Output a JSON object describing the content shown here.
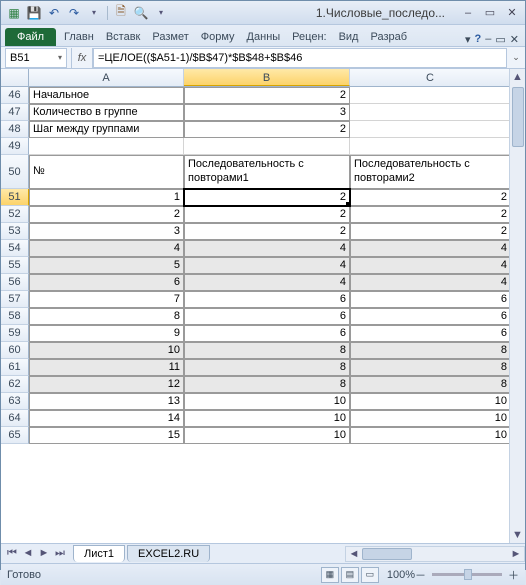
{
  "window": {
    "title": "1.Числовые_последо..."
  },
  "ribbon": {
    "file": "Файл",
    "tabs": [
      "Главн",
      "Вставк",
      "Размет",
      "Форму",
      "Данны",
      "Рецен:",
      "Вид",
      "Разраб"
    ]
  },
  "formulaBar": {
    "nameBox": "B51",
    "fx": "fx",
    "formula": "=ЦЕЛОЕ(($A51-1)/$B$47)*$B$48+$B$46"
  },
  "columns": [
    "A",
    "B",
    "C"
  ],
  "rows": [
    {
      "n": "46",
      "a": "Начальное",
      "b": "2",
      "c": "",
      "style": "param"
    },
    {
      "n": "47",
      "a": "Количество в группе",
      "b": "3",
      "c": "",
      "style": "param"
    },
    {
      "n": "48",
      "a": "Шаг между группами",
      "b": "2",
      "c": "",
      "style": "param"
    },
    {
      "n": "49",
      "a": "",
      "b": "",
      "c": "",
      "style": "blank"
    },
    {
      "n": "50",
      "a": "№",
      "b": "Последовательность с повторами1",
      "c": "Последовательность с повторами2",
      "style": "head"
    },
    {
      "n": "51",
      "a": "1",
      "b": "2",
      "c": "2",
      "style": "data",
      "sel": true
    },
    {
      "n": "52",
      "a": "2",
      "b": "2",
      "c": "2",
      "style": "data"
    },
    {
      "n": "53",
      "a": "3",
      "b": "2",
      "c": "2",
      "style": "data"
    },
    {
      "n": "54",
      "a": "4",
      "b": "4",
      "c": "4",
      "style": "data",
      "band": true
    },
    {
      "n": "55",
      "a": "5",
      "b": "4",
      "c": "4",
      "style": "data",
      "band": true
    },
    {
      "n": "56",
      "a": "6",
      "b": "4",
      "c": "4",
      "style": "data",
      "band": true
    },
    {
      "n": "57",
      "a": "7",
      "b": "6",
      "c": "6",
      "style": "data"
    },
    {
      "n": "58",
      "a": "8",
      "b": "6",
      "c": "6",
      "style": "data"
    },
    {
      "n": "59",
      "a": "9",
      "b": "6",
      "c": "6",
      "style": "data"
    },
    {
      "n": "60",
      "a": "10",
      "b": "8",
      "c": "8",
      "style": "data",
      "band": true
    },
    {
      "n": "61",
      "a": "11",
      "b": "8",
      "c": "8",
      "style": "data",
      "band": true
    },
    {
      "n": "62",
      "a": "12",
      "b": "8",
      "c": "8",
      "style": "data",
      "band": true
    },
    {
      "n": "63",
      "a": "13",
      "b": "10",
      "c": "10",
      "style": "data"
    },
    {
      "n": "64",
      "a": "14",
      "b": "10",
      "c": "10",
      "style": "data"
    },
    {
      "n": "65",
      "a": "15",
      "b": "10",
      "c": "10",
      "style": "data"
    }
  ],
  "sheets": {
    "active": "Лист1",
    "other": "EXCEL2.RU"
  },
  "status": {
    "ready": "Готово",
    "zoom": "100%"
  },
  "icons": {
    "excel": "▦",
    "save": "💾",
    "undo": "↶",
    "redo": "↷",
    "print": "🗎",
    "preview": "🔍",
    "dd": "▾",
    "min": "–",
    "max": "▭",
    "close": "✕",
    "left": "◄",
    "right": "►",
    "up": "▲",
    "down": "▼",
    "first": "⏮",
    "last": "⏭",
    "plus": "＋",
    "minus": "－",
    "help": "?",
    "exp": "⌄"
  }
}
